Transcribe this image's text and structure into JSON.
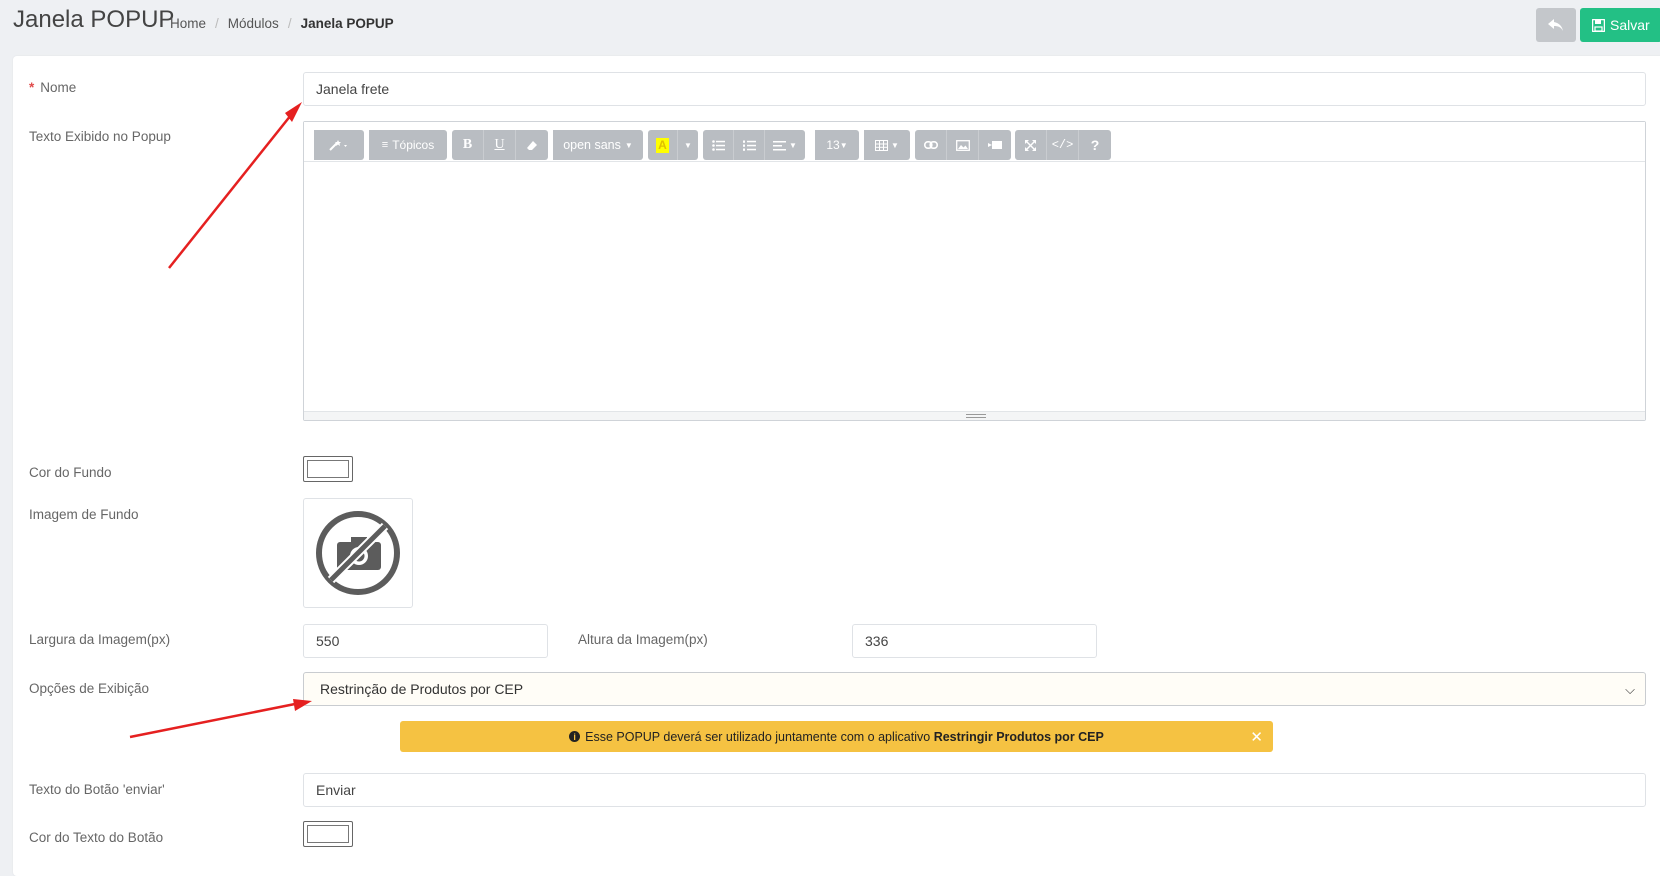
{
  "header": {
    "title": "Janela POPUP",
    "breadcrumb": [
      "Home",
      "Módulos",
      "Janela POPUP"
    ],
    "save_label": "Salvar"
  },
  "form": {
    "nome": {
      "label": "Nome",
      "value": "Janela frete"
    },
    "texto": {
      "label": "Texto Exibido no Popup",
      "toolbar": {
        "topicos": "Tópicos",
        "font": "open sans",
        "size": "13"
      }
    },
    "cor_fundo": {
      "label": "Cor do Fundo"
    },
    "imagem_fundo": {
      "label": "Imagem de Fundo"
    },
    "largura": {
      "label": "Largura da Imagem(px)",
      "value": "550"
    },
    "altura": {
      "label": "Altura da Imagem(px)",
      "value": "336"
    },
    "opcoes": {
      "label": "Opções de Exibição",
      "value": "Restrinção de Produtos por CEP"
    },
    "alert": {
      "text": "Esse POPUP deverá ser utilizado juntamente com o aplicativo",
      "bold": "Restringir Produtos por CEP"
    },
    "texto_botao": {
      "label": "Texto do Botão 'enviar'",
      "value": "Enviar"
    },
    "cor_texto_botao": {
      "label": "Cor do Texto do Botão"
    }
  },
  "annotations": {
    "arrow_color": "#e52020"
  },
  "colors": {
    "save": "#23c085",
    "alert": "#f5c242"
  }
}
